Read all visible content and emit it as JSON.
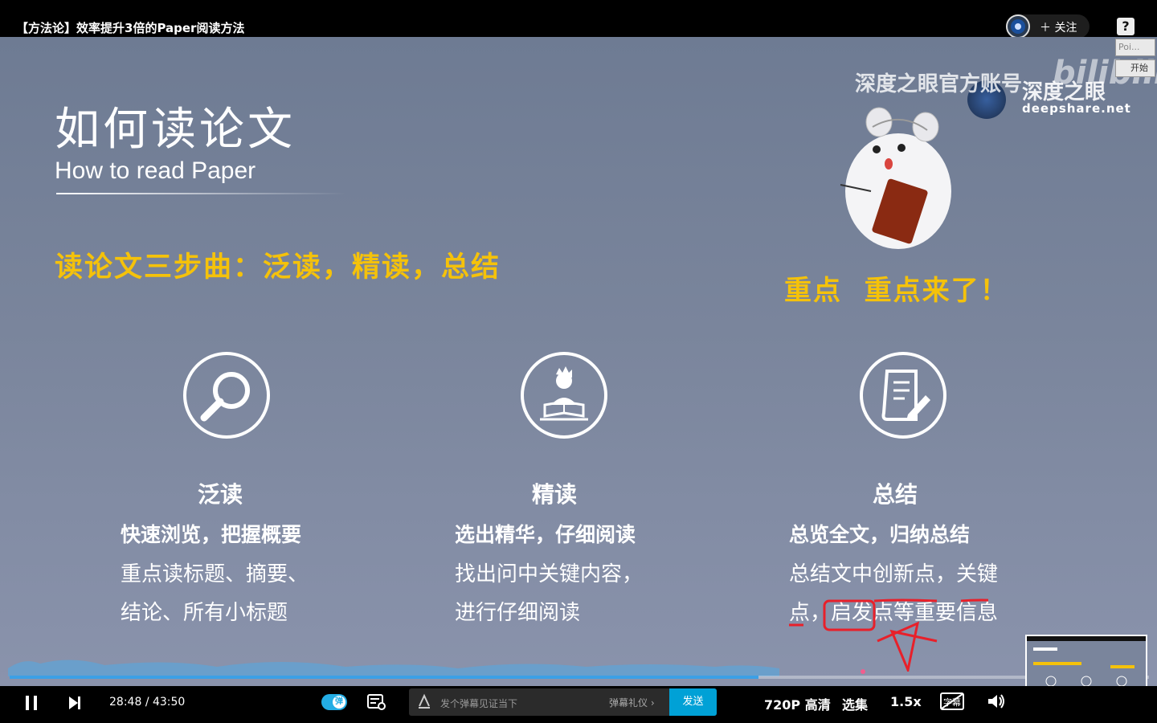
{
  "header": {
    "video_title": "【方法论】效率提升3倍的Paper阅读方法",
    "follow_label": "＋ 关注",
    "help_label": "?"
  },
  "side_panel": {
    "item_a": "Poi...",
    "item_b": "开始"
  },
  "slide": {
    "title": "如何读论文",
    "subtitle": "How to read Paper",
    "three_steps": "读论文三步曲：泛读，精读，总结",
    "highlight": "重点  重点来了！",
    "watermark_cn": "深度之眼官方账号",
    "watermark_cn2": "深度之眼",
    "watermark_domain": "deepshare.net",
    "watermark_bili": "bilibili",
    "columns": [
      {
        "title": "泛读",
        "subtitle": "快速浏览，把握概要",
        "line1": "重点读标题、摘要、",
        "line2": "结论、所有小标题",
        "icon": "magnifier-icon"
      },
      {
        "title": "精读",
        "subtitle": "选出精华，仔细阅读",
        "line1": "找出问中关键内容，",
        "line2": "进行仔细阅读",
        "icon": "reading-person-icon"
      },
      {
        "title": "总结",
        "subtitle": "总览全文，归纳总结",
        "line1": "总结文中创新点，关键",
        "line2": "点，启发点等重要信息",
        "icon": "document-pen-icon"
      }
    ]
  },
  "player": {
    "current_time": "28:48",
    "separator": "/",
    "duration": "43:50",
    "progress_fraction": 0.657,
    "danmaku_toggle_label": "弹",
    "danmaku_placeholder": "发个弹幕见证当下",
    "danmaku_etiquette": "弹幕礼仪 ›",
    "send_label": "发送",
    "quality_label": "720P 高清",
    "episodes_label": "选集",
    "speed_label": "1.5x",
    "subtitle_label": "字幕"
  },
  "colors": {
    "accent_yellow": "#f5c20a",
    "progress_blue": "#3ca0e6",
    "send_blue": "#00a1d6"
  }
}
